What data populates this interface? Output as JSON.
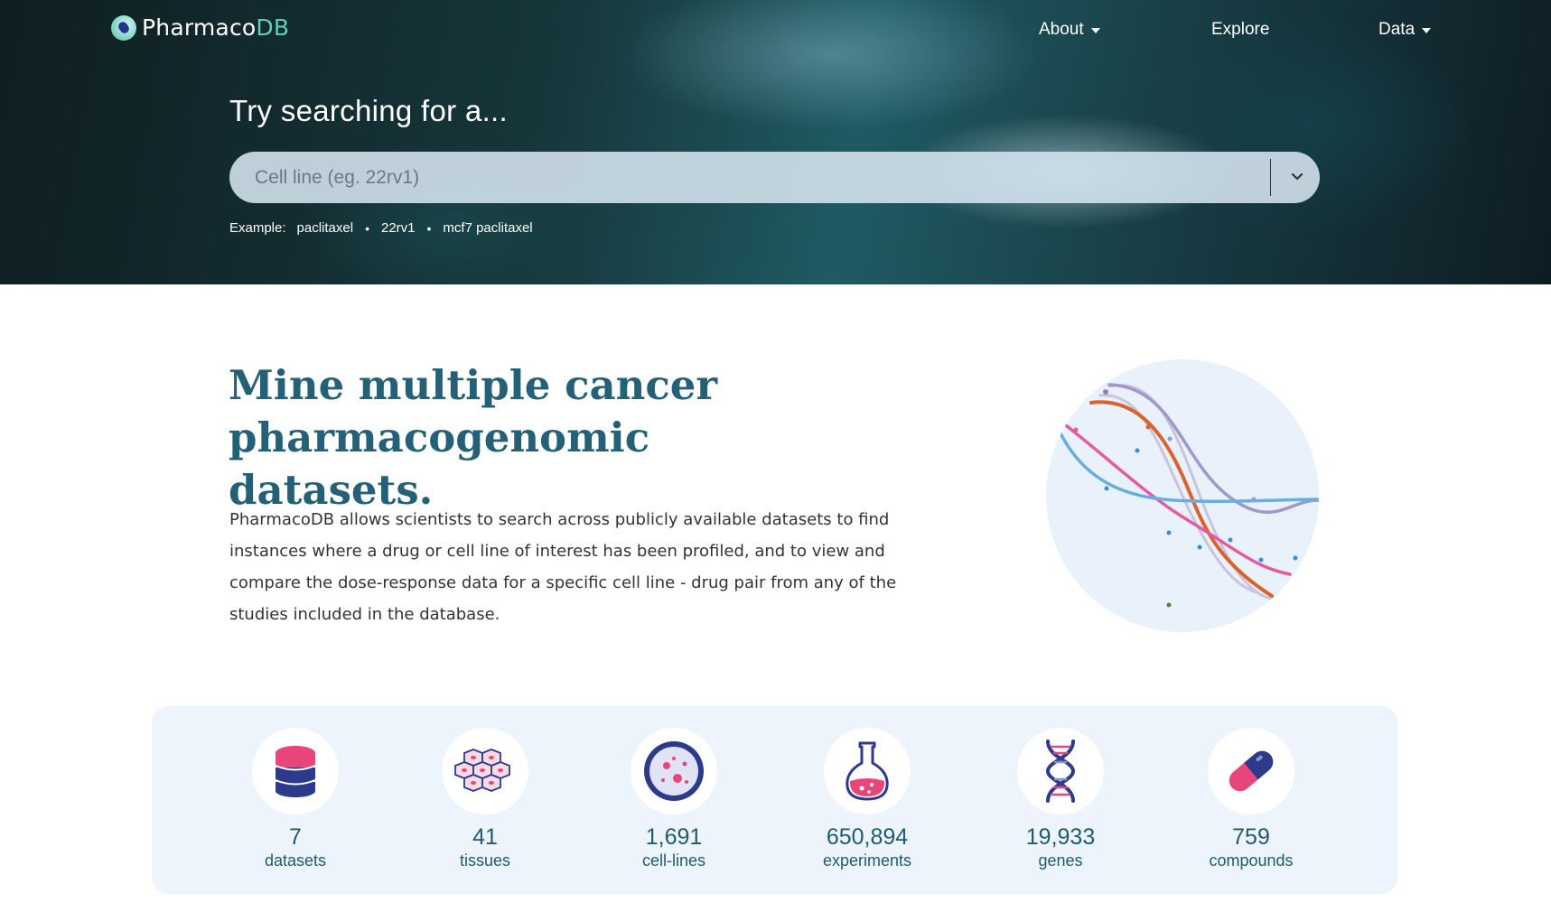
{
  "brand": {
    "name_part1": "Pharmaco",
    "name_part2": "DB",
    "accent_color": "#5fd0b8"
  },
  "nav": {
    "about": "About",
    "explore": "Explore",
    "data": "Data"
  },
  "search": {
    "heading": "Try searching for a...",
    "placeholder": "Cell line (eg. 22rv1)",
    "examples_label": "Example:",
    "examples": [
      "paclitaxel",
      "22rv1",
      "mcf7 paclitaxel"
    ]
  },
  "intro": {
    "headline_line1": "Mine multiple cancer",
    "headline_line2": "pharmacogenomic datasets.",
    "description": "PharmacoDB allows scientists to search across publicly available datasets to find instances where a drug or cell line of interest has been profiled, and to view and compare the dose-response data for a specific cell line - drug pair from any of the studies included in the database."
  },
  "stats": [
    {
      "value": "7",
      "label": "datasets",
      "icon": "database-icon"
    },
    {
      "value": "41",
      "label": "tissues",
      "icon": "tissue-icon"
    },
    {
      "value": "1,691",
      "label": "cell-lines",
      "icon": "petri-dish-icon"
    },
    {
      "value": "650,894",
      "label": "experiments",
      "icon": "flask-icon"
    },
    {
      "value": "19,933",
      "label": "genes",
      "icon": "dna-icon"
    },
    {
      "value": "759",
      "label": "compounds",
      "icon": "pill-icon"
    }
  ],
  "colors": {
    "headline": "#246176",
    "stat_text": "#1f5b70",
    "stats_panel_bg": "#edf4fc",
    "icon_pink": "#e8457a",
    "icon_navy": "#2d3a8c"
  }
}
